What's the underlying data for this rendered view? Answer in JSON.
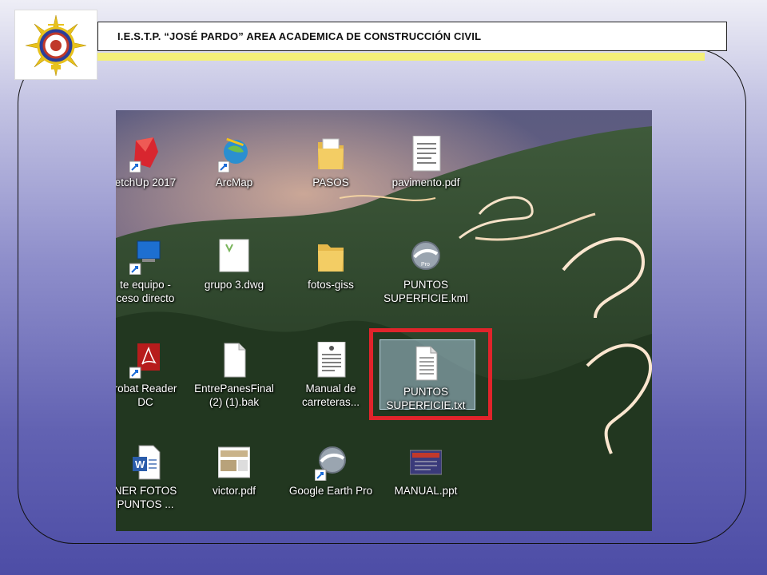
{
  "header": {
    "title": "I.E.S.T.P. “JOSÉ PARDO” AREA ACADEMICA DE CONSTRUCCIÓN CIVIL"
  },
  "colors": {
    "stripe": "#f4f079",
    "selection_box": "#e0242b"
  },
  "desktop": {
    "icons": [
      {
        "label": "etchUp 2017",
        "icon": "sketchup-icon"
      },
      {
        "label": "ArcMap",
        "icon": "arcmap-icon"
      },
      {
        "label": "PASOS",
        "icon": "folder-icon"
      },
      {
        "label": "pavimento.pdf",
        "icon": "pdf-document-icon"
      },
      {
        "label1": "te equipo -",
        "label2": "ceso directo",
        "icon": "computer-icon"
      },
      {
        "label": "grupo 3.dwg",
        "icon": "dwg-file-icon"
      },
      {
        "label": "fotos-giss",
        "icon": "folder-icon"
      },
      {
        "label1": "PUNTOS",
        "label2": "SUPERFICIE.kml",
        "icon": "google-earth-pro-file-icon"
      },
      {
        "label1": "robat Reader",
        "label2": "DC",
        "icon": "acrobat-reader-icon"
      },
      {
        "label1": "EntrePanesFinal",
        "label2": "(2) (1).bak",
        "icon": "blank-file-icon"
      },
      {
        "label1": "Manual de",
        "label2": "carreteras...",
        "icon": "document-icon"
      },
      {
        "label1": "PUNTOS",
        "label2": "SUPERFICIE.txt",
        "icon": "text-file-icon"
      },
      {
        "label1": "NER FOTOS",
        "label2": "PUNTOS ...",
        "icon": "word-document-icon"
      },
      {
        "label": "victor.pdf",
        "icon": "pdf-thumbnail-icon"
      },
      {
        "label": "Google Earth Pro",
        "icon": "google-earth-icon"
      },
      {
        "label": "MANUAL.ppt",
        "icon": "powerpoint-icon"
      }
    ]
  }
}
